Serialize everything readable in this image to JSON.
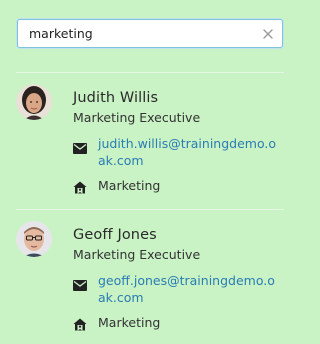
{
  "search": {
    "value": "marketing",
    "clear_icon": "close-icon"
  },
  "results": [
    {
      "name": "Judith Willis",
      "job_title": "Marketing Executive",
      "email": "judith.willis@trainingdemo.oak.com",
      "department": "Marketing",
      "avatar_icon": "person-avatar-female"
    },
    {
      "name": "Geoff Jones",
      "job_title": "Marketing Executive",
      "email": "geoff.jones@trainingdemo.oak.com",
      "department": "Marketing",
      "avatar_icon": "person-avatar-male-glasses"
    }
  ],
  "colors": {
    "background": "#c9f2c5",
    "link": "#2a7db3",
    "input_border": "#7fc2d9"
  }
}
